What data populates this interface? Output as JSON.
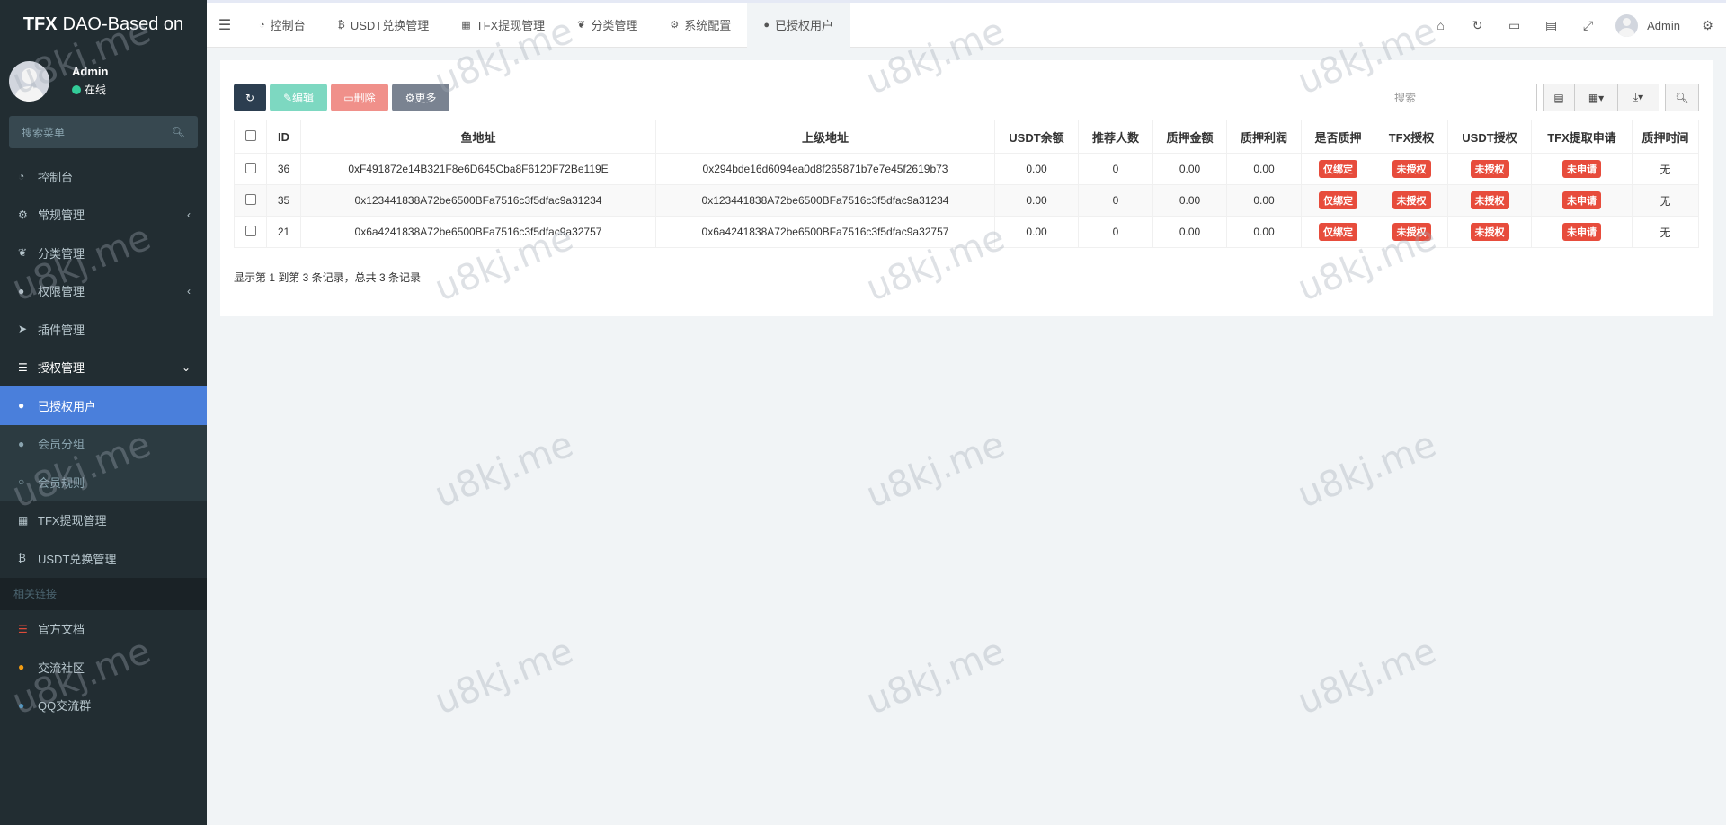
{
  "brand": {
    "bold": "TFX",
    "rest": "DAO-Based on"
  },
  "user": {
    "name": "Admin",
    "status": "在线"
  },
  "sidebar": {
    "search_placeholder": "搜索菜单",
    "items": [
      {
        "label": "控制台",
        "icon": "dashboard-icon"
      },
      {
        "label": "常规管理",
        "icon": "cogs-icon"
      },
      {
        "label": "分类管理",
        "icon": "leaf-icon"
      },
      {
        "label": "权限管理",
        "icon": "group-icon"
      },
      {
        "label": "插件管理",
        "icon": "rocket-icon"
      },
      {
        "label": "授权管理",
        "icon": "list-icon"
      },
      {
        "label": "已授权用户",
        "icon": "user-icon"
      },
      {
        "label": "会员分组",
        "icon": "users-icon"
      },
      {
        "label": "会员规则",
        "icon": "circle-icon"
      },
      {
        "label": "TFX提现管理",
        "icon": "id-card-icon"
      },
      {
        "label": "USDT兑换管理",
        "icon": "bitcoin-icon"
      },
      {
        "label": "相关链接"
      },
      {
        "label": "官方文档",
        "icon": "list-icon"
      },
      {
        "label": "交流社区",
        "icon": "comment-icon"
      },
      {
        "label": "QQ交流群",
        "icon": "qq-icon"
      }
    ]
  },
  "topnav": {
    "tabs": [
      {
        "label": "控制台"
      },
      {
        "label": "USDT兑换管理"
      },
      {
        "label": "TFX提现管理"
      },
      {
        "label": "分类管理"
      },
      {
        "label": "系统配置"
      },
      {
        "label": "已授权用户"
      }
    ],
    "user": "Admin"
  },
  "toolbar": {
    "edit": "编辑",
    "delete": "删除",
    "more": "更多",
    "search_placeholder": "搜索"
  },
  "table": {
    "headers": [
      "ID",
      "鱼地址",
      "上级地址",
      "USDT余额",
      "推荐人数",
      "质押金额",
      "质押利润",
      "是否质押",
      "TFX授权",
      "USDT授权",
      "TFX提取申请",
      "质押时间"
    ],
    "rows": [
      {
        "id": "36",
        "fish": "0xF491872e14B321F8e6D645Cba8F6120F72Be119E",
        "parent": "0x294bde16d6094ea0d8f265871b7e7e45f2619b73",
        "usdt": "0.00",
        "refs": "0",
        "stake": "0.00",
        "profit": "0.00",
        "staked": "仅绑定",
        "tfx": "未授权",
        "usdt_auth": "未授权",
        "withdraw": "未申请",
        "time": "无"
      },
      {
        "id": "35",
        "fish": "0x123441838A72be6500BFa7516c3f5dfac9a31234",
        "parent": "0x123441838A72be6500BFa7516c3f5dfac9a31234",
        "usdt": "0.00",
        "refs": "0",
        "stake": "0.00",
        "profit": "0.00",
        "staked": "仅绑定",
        "tfx": "未授权",
        "usdt_auth": "未授权",
        "withdraw": "未申请",
        "time": "无"
      },
      {
        "id": "21",
        "fish": "0x6a4241838A72be6500BFa7516c3f5dfac9a32757",
        "parent": "0x6a4241838A72be6500BFa7516c3f5dfac9a32757",
        "usdt": "0.00",
        "refs": "0",
        "stake": "0.00",
        "profit": "0.00",
        "staked": "仅绑定",
        "tfx": "未授权",
        "usdt_auth": "未授权",
        "withdraw": "未申请",
        "time": "无"
      }
    ],
    "footer": "显示第 1 到第 3 条记录，总共 3 条记录"
  },
  "watermark": "u8kj.me"
}
